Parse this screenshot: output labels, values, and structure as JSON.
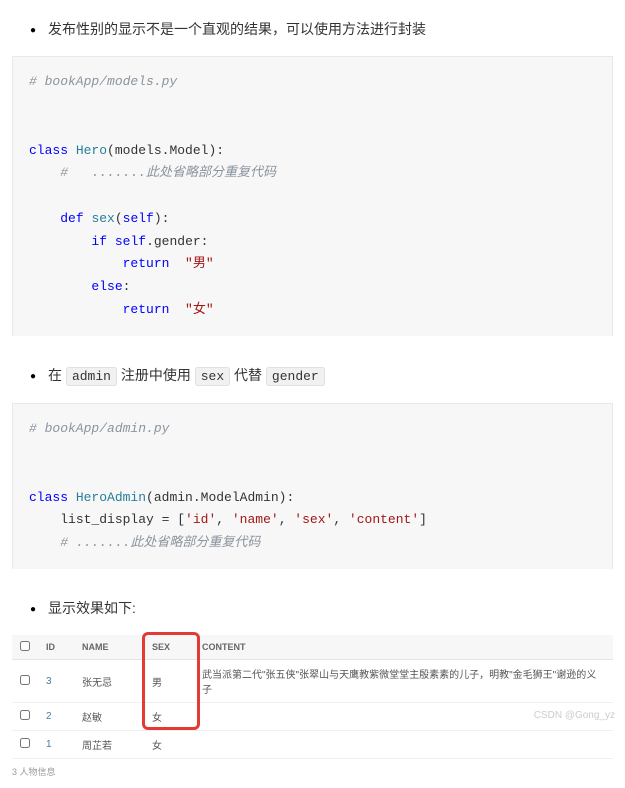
{
  "bullets": {
    "b1": "发布性别的显示不是一个直观的结果，可以使用方法进行封装",
    "b2_pre": "在 ",
    "b2_code1": "admin",
    "b2_mid": " 注册中使用 ",
    "b2_code2": "sex",
    "b2_mid2": " 代替 ",
    "b2_code3": "gender",
    "b3": "显示效果如下:"
  },
  "code1": {
    "c0": "# bookApp/models.py",
    "c1a": "class",
    "c1b": "Hero",
    "c1c": "(models.Model):",
    "c2a": "#",
    "c2b": ".......此处省略部分重复代码",
    "c3a": "def",
    "c3b": "sex",
    "c3c": "(",
    "c3d": "self",
    "c3e": "):",
    "c4a": "if",
    "c4b": "self",
    "c4c": ".gender:",
    "c5a": "return",
    "c5b": "\"男\"",
    "c6a": "else",
    "c6b": ":",
    "c7a": "return",
    "c7b": "\"女\""
  },
  "code2": {
    "c0": "# bookApp/admin.py",
    "c1a": "class",
    "c1b": "HeroAdmin",
    "c1c": "(admin.ModelAdmin):",
    "c2a": "list_display = [",
    "c2b": "'id'",
    "c2c": ", ",
    "c2d": "'name'",
    "c2e": ", ",
    "c2f": "'sex'",
    "c2g": ", ",
    "c2h": "'content'",
    "c2i": "]",
    "c3a": "# .......此处省略部分重复代码"
  },
  "table": {
    "headers": {
      "id": "ID",
      "name": "NAME",
      "sex": "SEX",
      "content": "CONTENT"
    },
    "rows": [
      {
        "id": "3",
        "name": "张无忌",
        "sex": "男",
        "content": "武当派第二代\"张五侠\"张翠山与天鹰教紫微堂堂主殷素素的儿子，明教\"金毛狮王\"谢逊的义子"
      },
      {
        "id": "2",
        "name": "赵敏",
        "sex": "女",
        "content": ""
      },
      {
        "id": "1",
        "name": "周芷若",
        "sex": "女",
        "content": ""
      }
    ]
  },
  "footer": "3 人物信息",
  "watermark": "CSDN @Gong_yz"
}
